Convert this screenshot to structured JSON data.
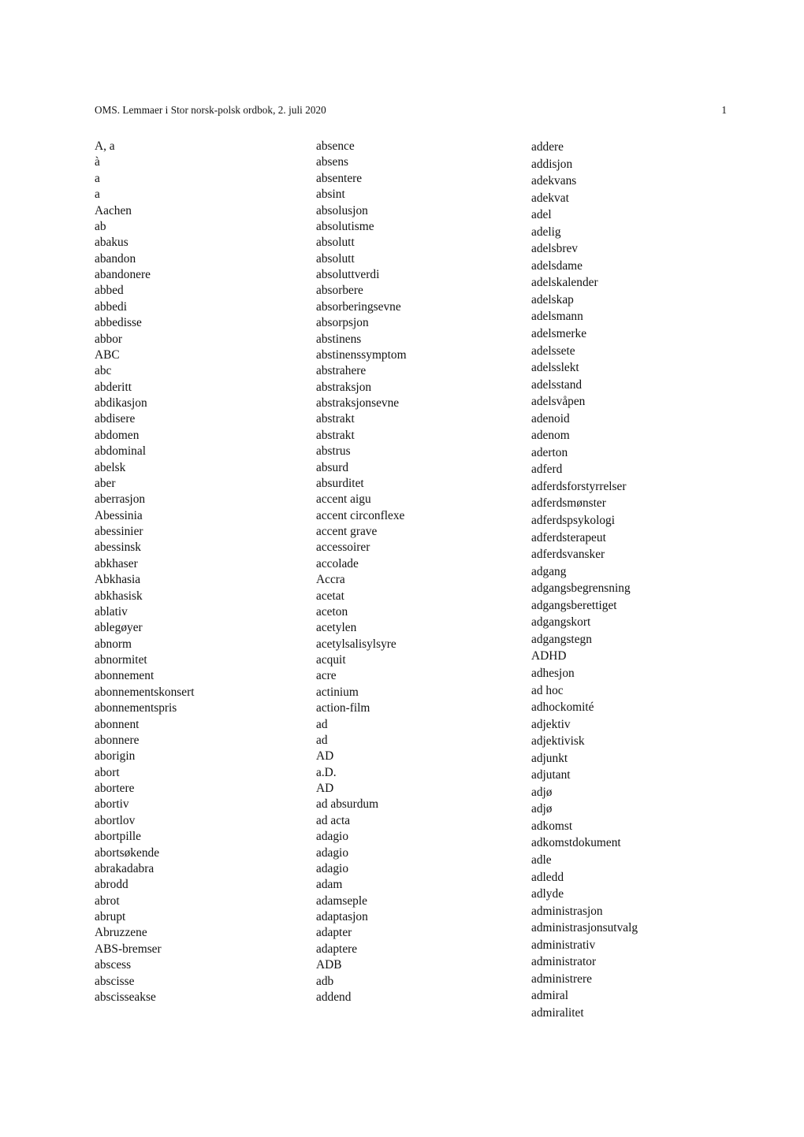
{
  "header": {
    "title": "OMS. Lemmaer i Stor norsk-polsk ordbok, 2. juli 2020",
    "page_number": "1"
  },
  "columns": [
    {
      "name": "column-1",
      "entries": [
        "A, a",
        "à",
        "a",
        "a",
        "Aachen",
        "ab",
        "abakus",
        "abandon",
        "abandonere",
        "abbed",
        "abbedi",
        "abbedisse",
        "abbor",
        "ABC",
        "abc",
        "abderitt",
        "abdikasjon",
        "abdisere",
        "abdomen",
        "abdominal",
        "abelsk",
        "aber",
        "aberrasjon",
        "Abessinia",
        "abessinier",
        "abessinsk",
        "abkhaser",
        "Abkhasia",
        "abkhasisk",
        "ablativ",
        "ablegøyer",
        "abnorm",
        "abnormitet",
        "abonnement",
        "abonnementskonsert",
        "abonnementspris",
        "abonnent",
        "abonnere",
        "aborigin",
        "abort",
        "abortere",
        "abortiv",
        "abortlov",
        "abortpille",
        "abortsøkende",
        "abrakadabra",
        "abrodd",
        "abrot",
        "abrupt",
        "Abruzzene",
        "ABS-bremser",
        "abscess",
        "abscisse",
        "abscisseakse"
      ]
    },
    {
      "name": "column-2",
      "entries": [
        "absence",
        "absens",
        "absentere",
        "absint",
        "absolusjon",
        "absolutisme",
        "absolutt",
        "absolutt",
        "absoluttverdi",
        "absorbere",
        "absorberingsevne",
        "absorpsjon",
        "abstinens",
        "abstinenssymptom",
        "abstrahere",
        "abstraksjon",
        "abstraksjonsevne",
        "abstrakt",
        "abstrakt",
        "abstrus",
        "absurd",
        "absurditet",
        "accent aigu",
        "accent circonflexe",
        "accent grave",
        "accessoirer",
        "accolade",
        "Accra",
        "acetat",
        "aceton",
        "acetylen",
        "acetylsalisylsyre",
        "acquit",
        "acre",
        "actinium",
        "action-film",
        "ad",
        "ad",
        "AD",
        "a.D.",
        "AD",
        "ad absurdum",
        "ad acta",
        "adagio",
        "adagio",
        "adagio",
        "adam",
        "adamseple",
        "adaptasjon",
        "adapter",
        "adaptere",
        "ADB",
        "adb",
        "addend"
      ]
    },
    {
      "name": "column-3",
      "entries": [
        "addere",
        "addisjon",
        "adekvans",
        "adekvat",
        "adel",
        "adelig",
        "adelsbrev",
        "adelsdame",
        "adelskalender",
        "adelskap",
        "adelsmann",
        "adelsmerke",
        "adelssete",
        "adelsslekt",
        "adelsstand",
        "adelsvåpen",
        "adenoid",
        "adenom",
        "aderton",
        "adferd",
        "adferdsforstyrrelser",
        "adferdsmønster",
        "adferdspsykologi",
        "adferdsterapeut",
        "adferdsvansker",
        "adgang",
        "adgangsbegrensning",
        "adgangsberettiget",
        "adgangskort",
        "adgangstegn",
        "ADHD",
        "adhesjon",
        "ad hoc",
        "adhockomité",
        "adjektiv",
        "adjektivisk",
        "adjunkt",
        "adjutant",
        "adjø",
        "adjø",
        "adkomst",
        "adkomstdokument",
        "adle",
        "adledd",
        "adlyde",
        "administrasjon",
        "administrasjonsutvalg",
        "administrativ",
        "administrator",
        "administrere",
        "admiral",
        "admiralitet"
      ]
    }
  ]
}
